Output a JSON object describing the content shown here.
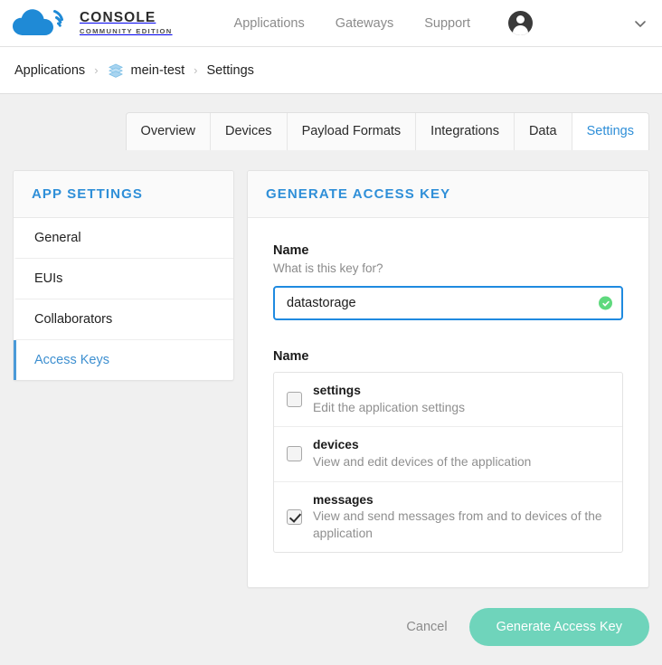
{
  "header": {
    "logo_icon": "cloud-signal-logo",
    "brand_title": "CONSOLE",
    "brand_subtitle": "COMMUNITY EDITION",
    "nav": [
      {
        "label": "Applications",
        "name": "nav-applications"
      },
      {
        "label": "Gateways",
        "name": "nav-gateways"
      },
      {
        "label": "Support",
        "name": "nav-support"
      }
    ],
    "avatar_icon": "user-avatar-icon",
    "caret_icon": "chevron-down-icon"
  },
  "breadcrumb": {
    "root": "Applications",
    "separator": "›",
    "app_icon": "layers-stack-icon",
    "app": "mein-test",
    "current": "Settings"
  },
  "tabs": [
    {
      "label": "Overview",
      "active": false
    },
    {
      "label": "Devices",
      "active": false
    },
    {
      "label": "Payload Formats",
      "active": false
    },
    {
      "label": "Integrations",
      "active": false
    },
    {
      "label": "Data",
      "active": false
    },
    {
      "label": "Settings",
      "active": true
    }
  ],
  "sidebar": {
    "title": "APP SETTINGS",
    "items": [
      {
        "label": "General",
        "active": false
      },
      {
        "label": "EUIs",
        "active": false
      },
      {
        "label": "Collaborators",
        "active": false
      },
      {
        "label": "Access Keys",
        "active": true
      }
    ]
  },
  "panel": {
    "title": "GENERATE ACCESS KEY",
    "name_field": {
      "label": "Name",
      "hint": "What is this key for?",
      "value": "datastorage",
      "placeholder": "",
      "valid_icon": "check-circle-icon"
    },
    "rights": {
      "label": "Name",
      "items": [
        {
          "name": "settings",
          "description": "Edit the application settings",
          "checked": false
        },
        {
          "name": "devices",
          "description": "View and edit devices of the application",
          "checked": false
        },
        {
          "name": "messages",
          "description": "View and send messages from and to devices of the application",
          "checked": true
        }
      ]
    }
  },
  "actions": {
    "cancel_label": "Cancel",
    "submit_label": "Generate Access Key"
  },
  "colors": {
    "accent_blue": "#2f8fd8",
    "logo_blue": "#1f8ad6",
    "focus_blue": "#1f8ae0",
    "success_green": "#5fd97e",
    "primary_button": "#6fd4bb",
    "page_bg": "#f0f0f0"
  }
}
